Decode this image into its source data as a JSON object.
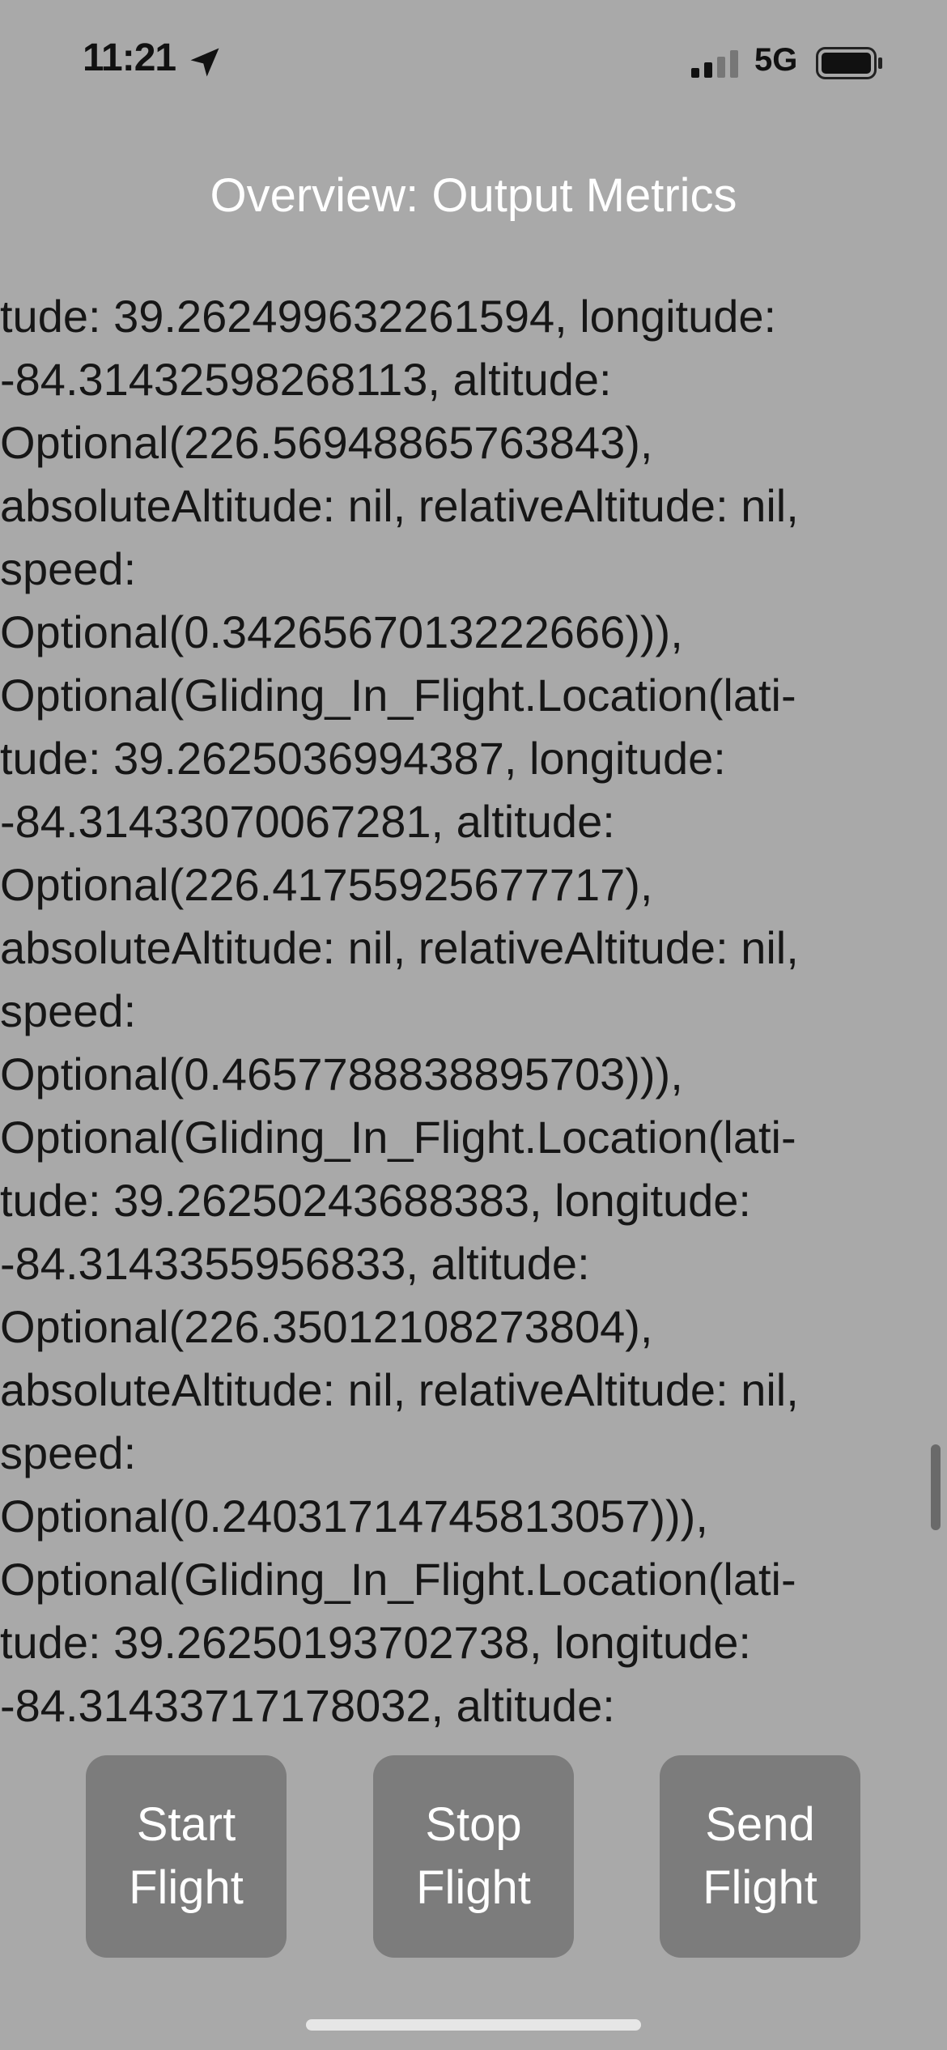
{
  "status_bar": {
    "time": "11:21",
    "network": "5G",
    "icons": [
      "location-arrow-icon",
      "signal-bars-icon",
      "battery-icon"
    ]
  },
  "nav": {
    "title": "Overview: Output Metrics"
  },
  "log": {
    "lines": [
      "tude: 39.262499632261594, longitude:",
      "-84.31432598268113, altitude:",
      "Optional(226.56948865763843),",
      "absoluteAltitude: nil, relativeAltitude: nil,",
      "speed:",
      "Optional(0.3426567013222666))),",
      "Optional(Gliding_In_Flight.Location(lati-",
      "tude: 39.2625036994387, longitude:",
      "-84.31433070067281, altitude:",
      "Optional(226.41755925677717),",
      "absoluteAltitude: nil, relativeAltitude: nil,",
      "speed:",
      "Optional(0.4657788838895703))),",
      "Optional(Gliding_In_Flight.Location(lati-",
      "tude: 39.26250243688383, longitude:",
      "-84.3143355956833, altitude:",
      "Optional(226.35012108273804),",
      "absoluteAltitude: nil, relativeAltitude: nil,",
      "speed:",
      "Optional(0.24031714745813057))),",
      "Optional(Gliding_In_Flight.Location(lati-",
      "tude: 39.26250193702738, longitude:",
      "-84.31433717178032, altitude:"
    ]
  },
  "buttons": {
    "start": [
      "Start",
      "Flight"
    ],
    "stop": [
      "Stop",
      "Flight"
    ],
    "send": [
      "Send",
      "Flight"
    ]
  },
  "colors": {
    "background": "#a9a9a9",
    "button": "#7c7c7c",
    "title_text": "#ffffff",
    "log_text": "#161616"
  }
}
